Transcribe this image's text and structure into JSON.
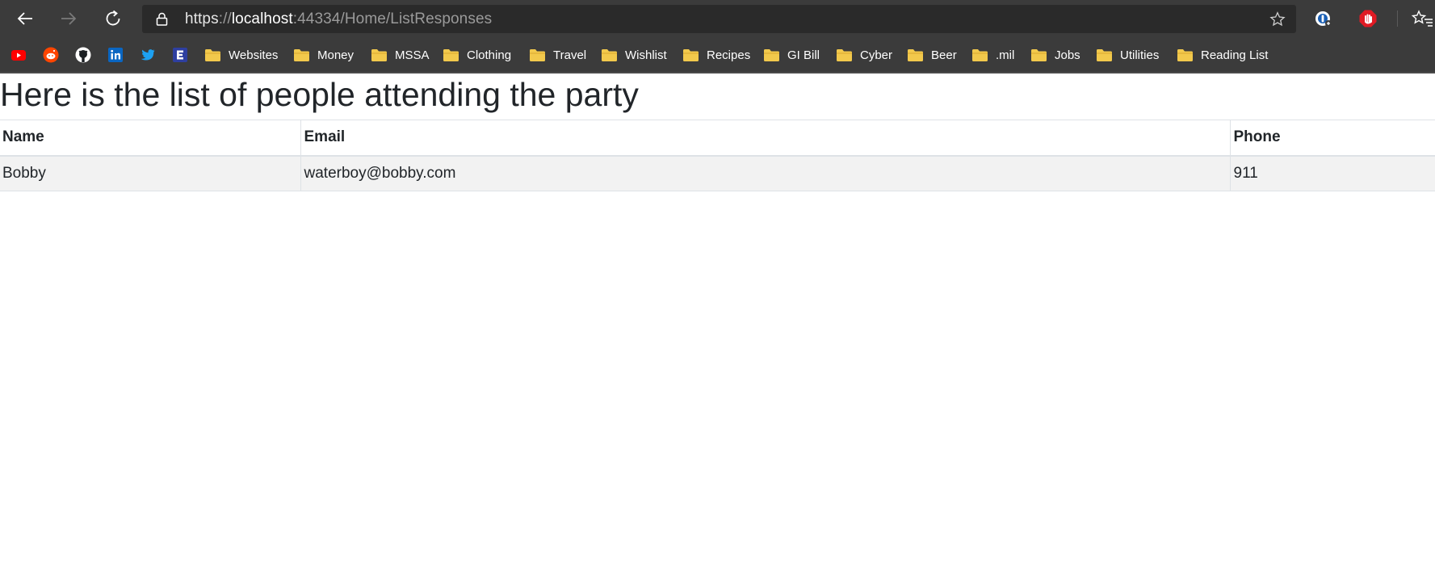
{
  "browser": {
    "url": {
      "scheme": "https",
      "separator": "://",
      "host": "localhost",
      "rest": ":44334/Home/ListResponses"
    },
    "icons": {
      "back": "arrow-left-icon",
      "forward": "arrow-right-icon",
      "refresh": "refresh-icon",
      "lock": "lock-icon",
      "star": "star-icon",
      "extension_1": "password-manager-icon",
      "extension_2": "adblock-icon",
      "favorites": "favorites-icon"
    },
    "colors": {
      "chrome": "#3b3b3b",
      "address_bar": "#2a2a2a",
      "folder": "#f2c94c"
    }
  },
  "bookmarks": {
    "sites": [
      {
        "name": "youtube-icon",
        "color": "#ff0000"
      },
      {
        "name": "reddit-icon",
        "color": "#ff4500"
      },
      {
        "name": "github-icon",
        "color": "#1b1f23"
      },
      {
        "name": "linkedin-icon",
        "color": "#0a66c2"
      },
      {
        "name": "twitter-icon",
        "color": "#1da1f2"
      },
      {
        "name": "e-icon",
        "color": "#2e3fa0"
      }
    ],
    "folders": [
      "Websites",
      "Money",
      "MSSA",
      "Clothing",
      "Travel",
      "Wishlist",
      "Recipes",
      "GI Bill",
      "Cyber",
      "Beer",
      ".mil",
      "Jobs",
      "Utilities",
      "Reading List"
    ]
  },
  "page": {
    "title": "Here is the list of people attending the party",
    "table": {
      "headers": [
        "Name",
        "Email",
        "Phone"
      ],
      "rows": [
        [
          "Bobby",
          "waterboy@bobby.com",
          "911"
        ]
      ]
    }
  }
}
